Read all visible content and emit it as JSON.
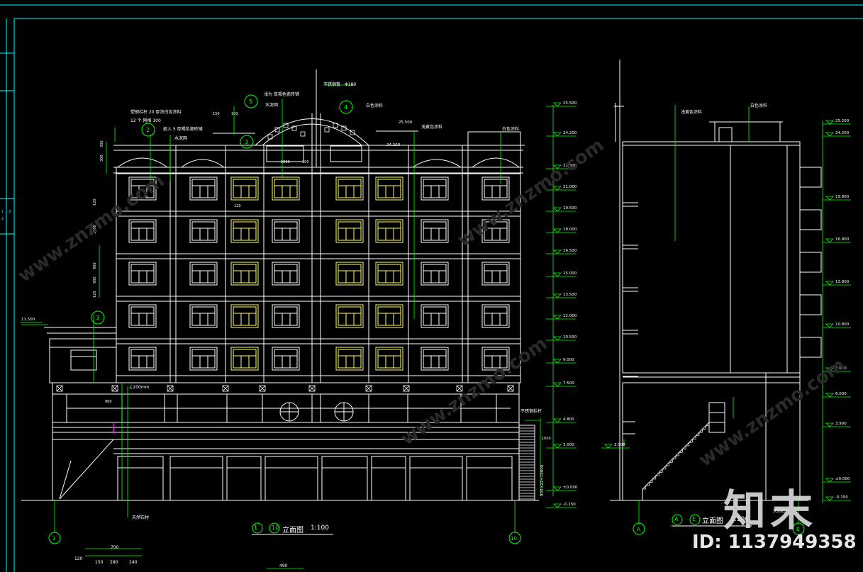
{
  "drawing": {
    "colors": {
      "background": "#000000",
      "frame": "#00ffff",
      "building": "#ffffff",
      "dimension": "#00ff00",
      "window_highlight": "#ffff66",
      "accent_magenta": "#ff00ff"
    },
    "elevation_1": {
      "title_axes": [
        "1",
        "10"
      ],
      "title_text": "立面图",
      "scale": "1:100"
    },
    "elevation_2": {
      "title_axes": [
        "A",
        "E"
      ],
      "title_text": "立面图",
      "scale": "1:100"
    },
    "axis_bubbles": [
      "1",
      "10",
      "A",
      "E"
    ],
    "callouts": [
      "2",
      "3",
      "3",
      "4",
      "5"
    ],
    "annotations": {
      "roof_mid": "不锈钢管",
      "roof_mid_dim": "Φ180",
      "callout5_note": "浅为 厚褐色瓷砖铺",
      "callout5_sub": "水泥网",
      "white_paint_top": "白色涂料",
      "white_paint_right": "白色涂料",
      "paint_right_mid": "浅黄色涂料",
      "left_top_1": "塑钢栏杆 20 厚涂白色涂料",
      "left_top_2": "12 个 网格 100",
      "left_mid": "嵌入 5 厚褐色瓷砖铺",
      "left_mid_sub": "水泥网",
      "rail_right": "不锈钢栏杆",
      "bottom_note": "天然石材",
      "side_top": "白色涂料",
      "side_mid": "浅黄色涂料",
      "side_bottom": "天然石材",
      "window_dim": "∠200mm"
    },
    "elevations_left": [
      "25.500",
      "24.200",
      "22.500",
      "21.000",
      "19.500",
      "18.000",
      "16.500",
      "15.000",
      "13.500",
      "12.000",
      "10.500",
      "9.000",
      "7.500",
      "4.800",
      "3.000",
      "±0.000",
      "-0.150"
    ],
    "elevations_right": [
      "25.200",
      "24.200",
      "19.800",
      "16.800",
      "13.800",
      "10.800",
      "7.800",
      "6.000",
      "3.900",
      "3.500",
      "±0.000",
      "-0.150"
    ],
    "elevation_left_small": "11.500",
    "top_markers": [
      "25.500",
      "24.200"
    ],
    "dims_bottom": [
      "700",
      "150",
      "280",
      "240",
      "120",
      "490"
    ],
    "dims_vertical_left": [
      "300",
      "300",
      "120",
      "1500",
      "900",
      "900",
      "120"
    ],
    "dims_misc": [
      "150",
      "100",
      "2800",
      "100",
      "120",
      "1650",
      "900"
    ],
    "dim_stair": "900×22=19800",
    "watermark": {
      "brand": "知末",
      "id_text": "ID: 1137949358",
      "diag": "www.znzmo.com"
    }
  }
}
